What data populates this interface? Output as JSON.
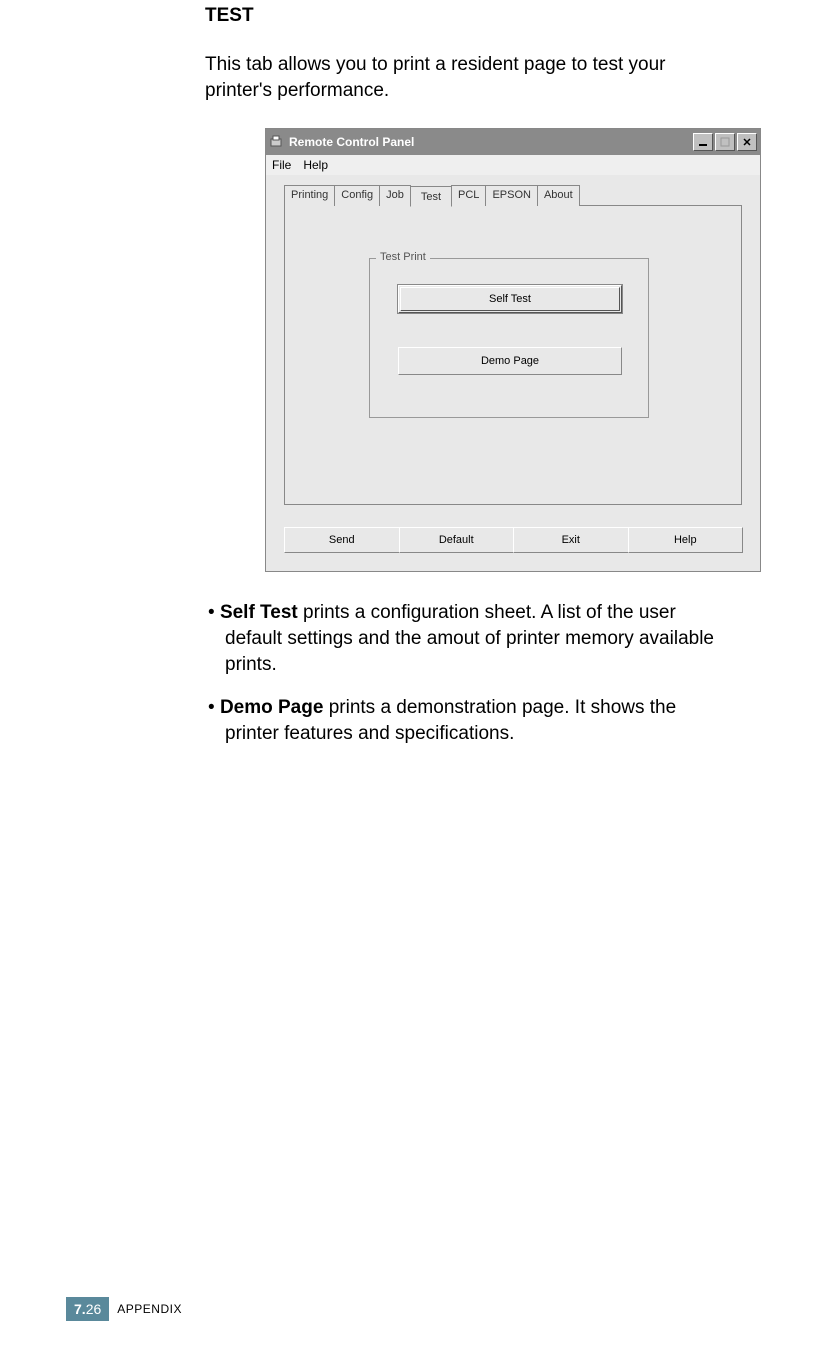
{
  "heading": "TEST",
  "intro": "This tab allows you to print a resident page to test your printer's performance.",
  "window": {
    "title": "Remote Control Panel",
    "menus": [
      "File",
      "Help"
    ],
    "tabs": [
      "Printing",
      "Config",
      "Job",
      "Test",
      "PCL",
      "EPSON",
      "About"
    ],
    "active_tab_index": 3,
    "fieldset_legend": "Test Print",
    "buttons": {
      "self_test": "Self Test",
      "demo_page": "Demo Page"
    },
    "bottom_buttons": [
      "Send",
      "Default",
      "Exit",
      "Help"
    ]
  },
  "bullets": [
    {
      "bold": "Self Test",
      "rest": " prints a configuration sheet. A list of the user default settings and the amout of printer memory available prints."
    },
    {
      "bold": "Demo Page",
      "rest": " prints a demonstration page. It shows the printer features and specifications."
    }
  ],
  "footer": {
    "chapter": "7.",
    "page": "26",
    "label": "APPENDIX"
  }
}
